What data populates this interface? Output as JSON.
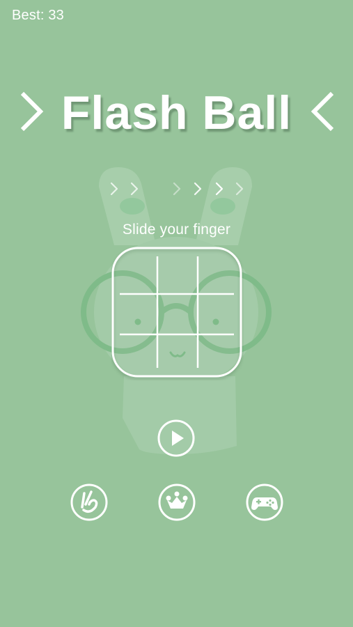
{
  "header": {
    "best_label": "Best: 33"
  },
  "title": {
    "text": "Flash Ball"
  },
  "tutorial": {
    "hint": "Slide your finger"
  },
  "buttons": {
    "play": "play-icon",
    "gesture": "hand-icon",
    "leaderboard": "crown-icon",
    "games": "gamepad-icon"
  },
  "colors": {
    "background": "#97c49b",
    "mascot": "#a7ceab",
    "mascot_outline": "#7fbb89",
    "foreground": "#ffffff"
  }
}
